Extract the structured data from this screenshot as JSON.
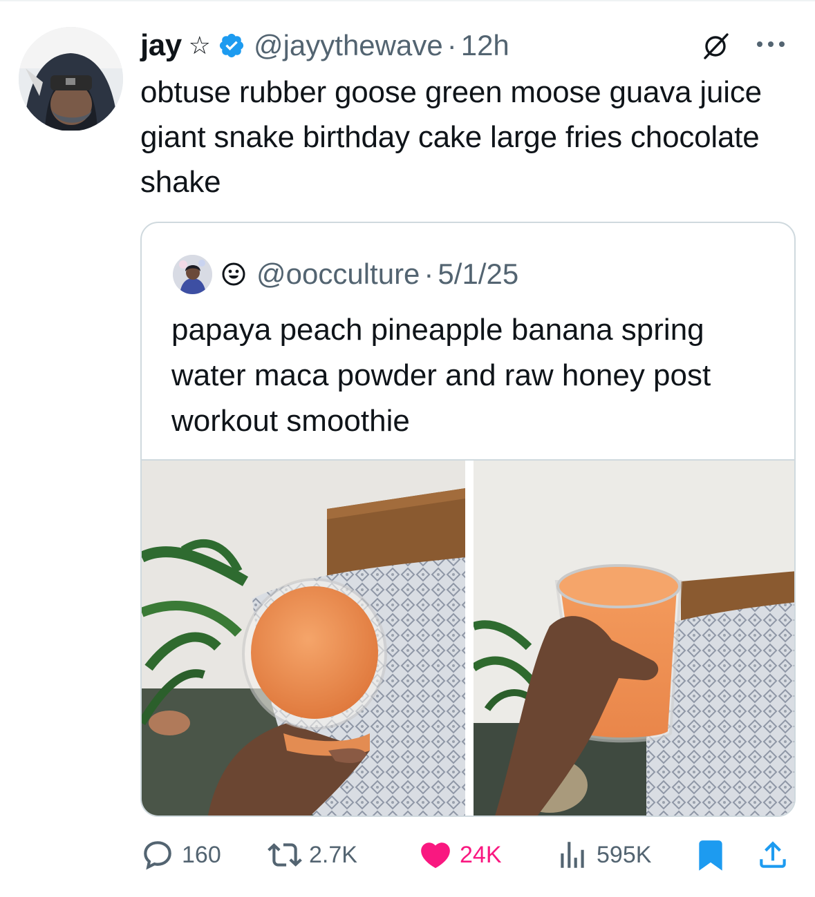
{
  "tweet": {
    "author": {
      "name": "jay",
      "name_emoji": "☆",
      "handle": "@jayythewave",
      "time": "12h",
      "verified": true
    },
    "text": "obtuse rubber goose green moose guava juice giant snake birthday cake large fries chocolate shake",
    "quote": {
      "handle": "@oocculture",
      "date": "5/1/25",
      "text": "papaya peach pineapple banana spring water maca powder and raw honey post workout smoothie",
      "media": [
        "smoothie-photo-1",
        "smoothie-photo-2"
      ]
    },
    "actions": {
      "replies": "160",
      "reposts": "2.7K",
      "likes": "24K",
      "views": "595K"
    }
  },
  "colors": {
    "accent": "#1d9bf0",
    "like": "#f91880",
    "muted": "#536471",
    "text": "#0f1419",
    "border": "#cfd9de"
  },
  "icons": {
    "verified": "verified-badge-icon",
    "grok": "grok-icon",
    "more": "more-icon",
    "reply": "reply-icon",
    "repost": "repost-icon",
    "like": "heart-icon",
    "views": "views-icon",
    "bookmark": "bookmark-icon",
    "share": "share-icon"
  }
}
